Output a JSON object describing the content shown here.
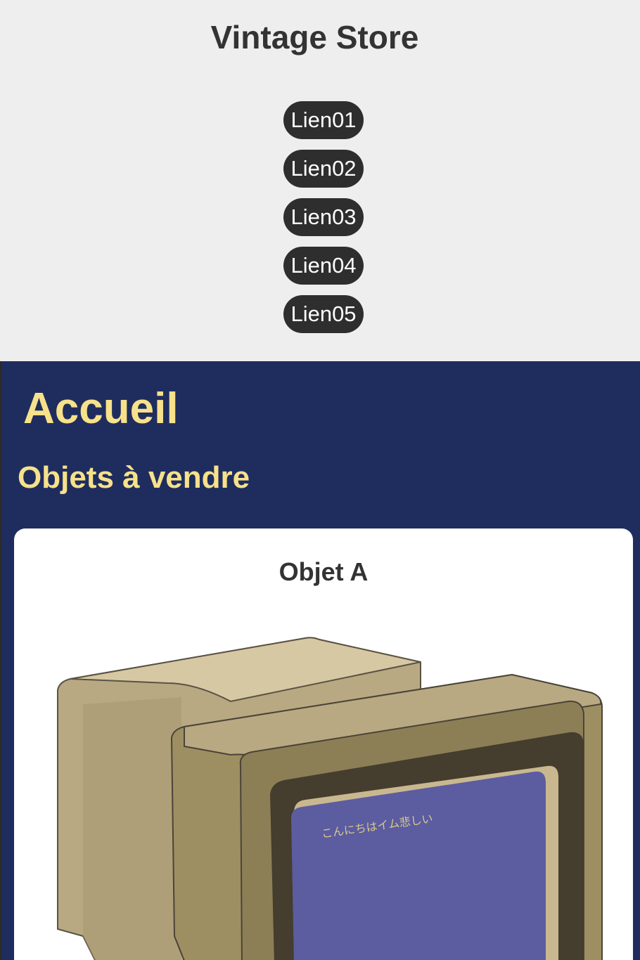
{
  "header": {
    "site_title": "Vintage Store",
    "nav": [
      {
        "label": "Lien01"
      },
      {
        "label": "Lien02"
      },
      {
        "label": "Lien03"
      },
      {
        "label": "Lien04"
      },
      {
        "label": "Lien05"
      }
    ]
  },
  "main": {
    "page_title": "Accueil",
    "section_title": "Objets à vendre",
    "products": [
      {
        "title": "Objet A",
        "image_icon": "retro-computer-monitor-icon",
        "screen_text": "こんにちはイム悲しい"
      }
    ]
  },
  "colors": {
    "header_bg": "#eeeeee",
    "nav_bg": "#2e2e2e",
    "main_bg": "#1f2d5e",
    "accent_yellow": "#f7e18a",
    "card_bg": "#ffffff",
    "screen_blue": "#5c5ca0"
  }
}
